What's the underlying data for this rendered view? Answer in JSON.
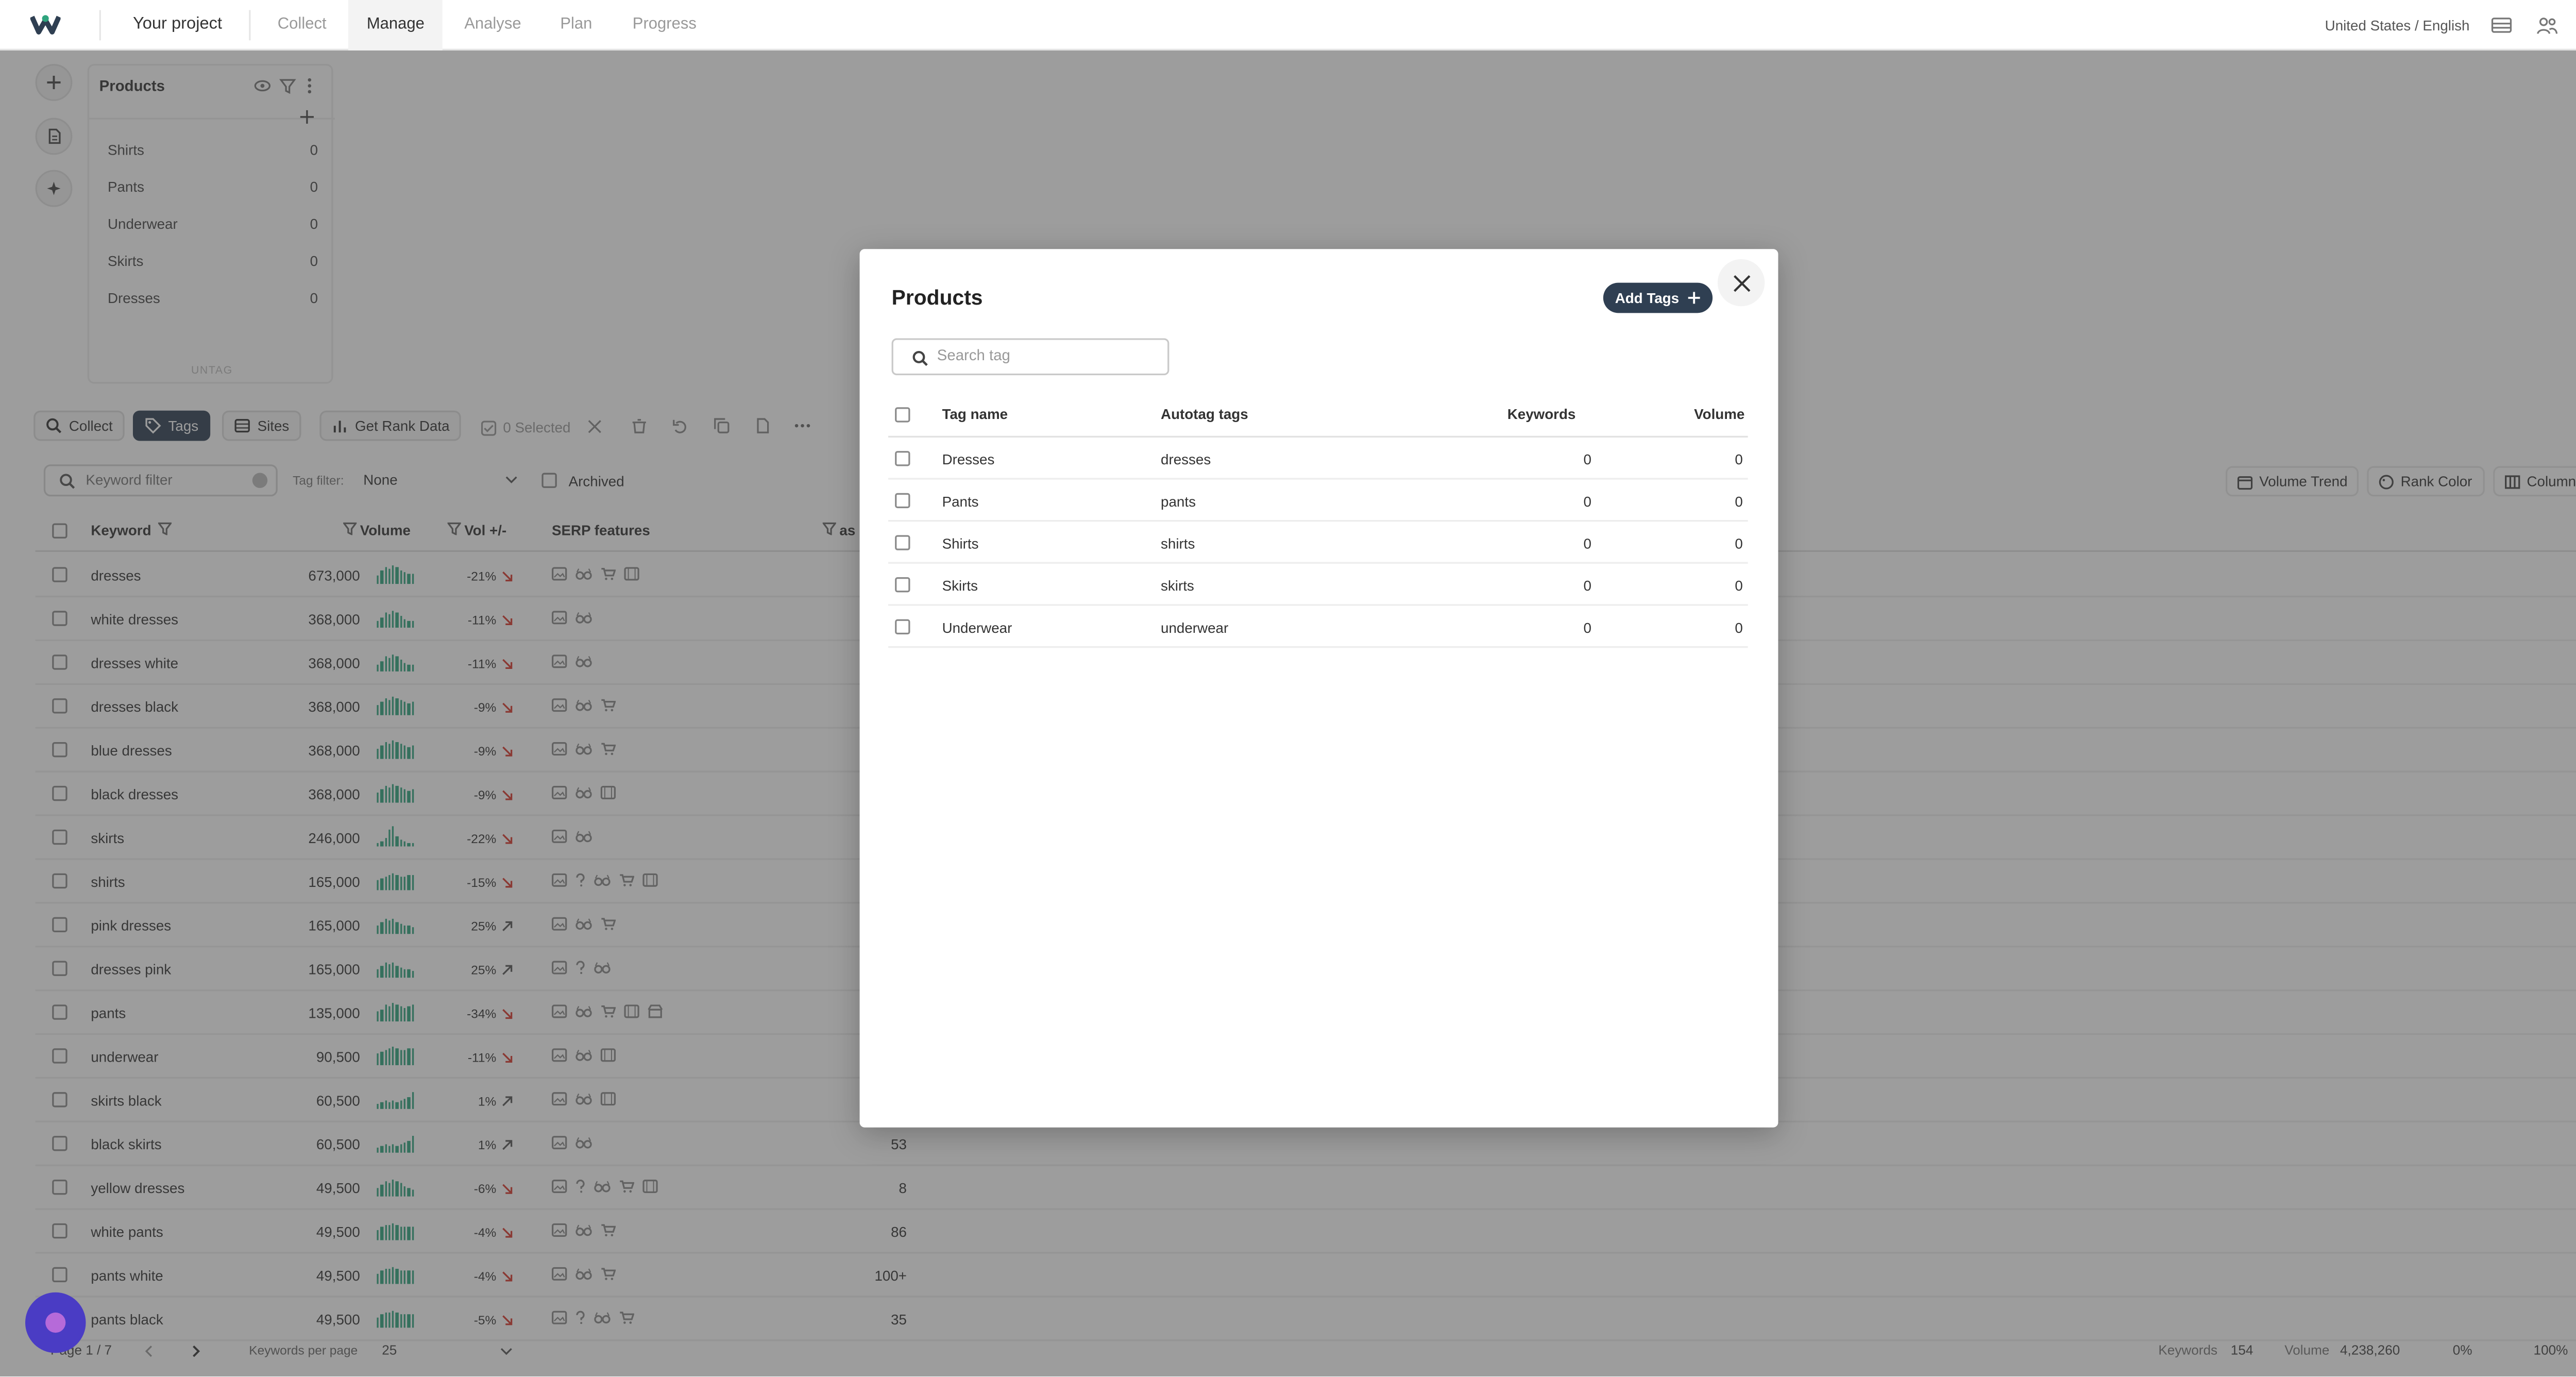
{
  "nav": {
    "project": "Your project",
    "tabs": [
      {
        "label": "Collect"
      },
      {
        "label": "Manage"
      },
      {
        "label": "Analyse"
      },
      {
        "label": "Plan"
      },
      {
        "label": "Progress"
      }
    ],
    "active_tab": "Manage",
    "locale": "United States / English"
  },
  "tag_panel": {
    "title": "Products",
    "items": [
      {
        "label": "Shirts",
        "count": "0"
      },
      {
        "label": "Pants",
        "count": "0"
      },
      {
        "label": "Underwear",
        "count": "0"
      },
      {
        "label": "Skirts",
        "count": "0"
      },
      {
        "label": "Dresses",
        "count": "0"
      }
    ],
    "untag": "UNTAG"
  },
  "toolbar": {
    "collect": "Collect",
    "tags": "Tags",
    "sites": "Sites",
    "get_rank_data": "Get Rank Data",
    "selected": "0 Selected",
    "volume_trend": "Volume Trend",
    "rank_color": "Rank Color",
    "columns": "Columns"
  },
  "filters": {
    "keyword_placeholder": "Keyword filter",
    "tag_filter_label": "Tag filter:",
    "tag_filter_value": "None",
    "archived": "Archived"
  },
  "table": {
    "headers": {
      "keyword": "Keyword",
      "volume": "Volume",
      "vol_change": "Vol +/-",
      "serp": "SERP features",
      "extra": "as"
    },
    "rows": [
      {
        "keyword": "dresses",
        "volume": "673,000",
        "change": "-21%",
        "dir": "down",
        "rank": ""
      },
      {
        "keyword": "white dresses",
        "volume": "368,000",
        "change": "-11%",
        "dir": "down",
        "rank": ""
      },
      {
        "keyword": "dresses white",
        "volume": "368,000",
        "change": "-11%",
        "dir": "down",
        "rank": ""
      },
      {
        "keyword": "dresses black",
        "volume": "368,000",
        "change": "-9%",
        "dir": "down",
        "rank": ""
      },
      {
        "keyword": "blue dresses",
        "volume": "368,000",
        "change": "-9%",
        "dir": "down",
        "rank": ""
      },
      {
        "keyword": "black dresses",
        "volume": "368,000",
        "change": "-9%",
        "dir": "down",
        "rank": ""
      },
      {
        "keyword": "skirts",
        "volume": "246,000",
        "change": "-22%",
        "dir": "down",
        "rank": ""
      },
      {
        "keyword": "shirts",
        "volume": "165,000",
        "change": "-15%",
        "dir": "down",
        "rank": ""
      },
      {
        "keyword": "pink dresses",
        "volume": "165,000",
        "change": "25%",
        "dir": "up",
        "rank": ""
      },
      {
        "keyword": "dresses pink",
        "volume": "165,000",
        "change": "25%",
        "dir": "up",
        "rank": ""
      },
      {
        "keyword": "pants",
        "volume": "135,000",
        "change": "-34%",
        "dir": "down",
        "rank": ""
      },
      {
        "keyword": "underwear",
        "volume": "90,500",
        "change": "-11%",
        "dir": "down",
        "rank": ""
      },
      {
        "keyword": "skirts black",
        "volume": "60,500",
        "change": "1%",
        "dir": "up",
        "rank": ""
      },
      {
        "keyword": "black skirts",
        "volume": "60,500",
        "change": "1%",
        "dir": "up",
        "rank": "53"
      },
      {
        "keyword": "yellow dresses",
        "volume": "49,500",
        "change": "-6%",
        "dir": "down",
        "rank": "8"
      },
      {
        "keyword": "white pants",
        "volume": "49,500",
        "change": "-4%",
        "dir": "down",
        "rank": "86"
      },
      {
        "keyword": "pants white",
        "volume": "49,500",
        "change": "-4%",
        "dir": "down",
        "rank": "100+"
      },
      {
        "keyword": "pants black",
        "volume": "49,500",
        "change": "-5%",
        "dir": "down",
        "rank": "35"
      }
    ]
  },
  "footer": {
    "page": "Page 1 / 7",
    "per_page_label": "Keywords per page",
    "per_page_value": "25",
    "keywords_label": "Keywords",
    "keywords_value": "154",
    "volume_label": "Volume",
    "volume_value": "4,238,260",
    "pct1": "0%",
    "pct2": "100%"
  },
  "modal": {
    "title": "Products",
    "add_tags": "Add Tags",
    "search_placeholder": "Search tag",
    "headers": {
      "tag_name": "Tag name",
      "autotag": "Autotag tags",
      "keywords": "Keywords",
      "volume": "Volume"
    },
    "rows": [
      {
        "name": "Dresses",
        "autotag": "dresses",
        "keywords": "0",
        "volume": "0"
      },
      {
        "name": "Pants",
        "autotag": "pants",
        "keywords": "0",
        "volume": "0"
      },
      {
        "name": "Shirts",
        "autotag": "shirts",
        "keywords": "0",
        "volume": "0"
      },
      {
        "name": "Skirts",
        "autotag": "skirts",
        "keywords": "0",
        "volume": "0"
      },
      {
        "name": "Underwear",
        "autotag": "underwear",
        "keywords": "0",
        "volume": "0"
      }
    ]
  },
  "colors": {
    "accent_dark": "#2f3f52",
    "trend_green": "#2fa47e",
    "negative_red": "#d9362b",
    "chat_purple": "#4a3cc4"
  }
}
